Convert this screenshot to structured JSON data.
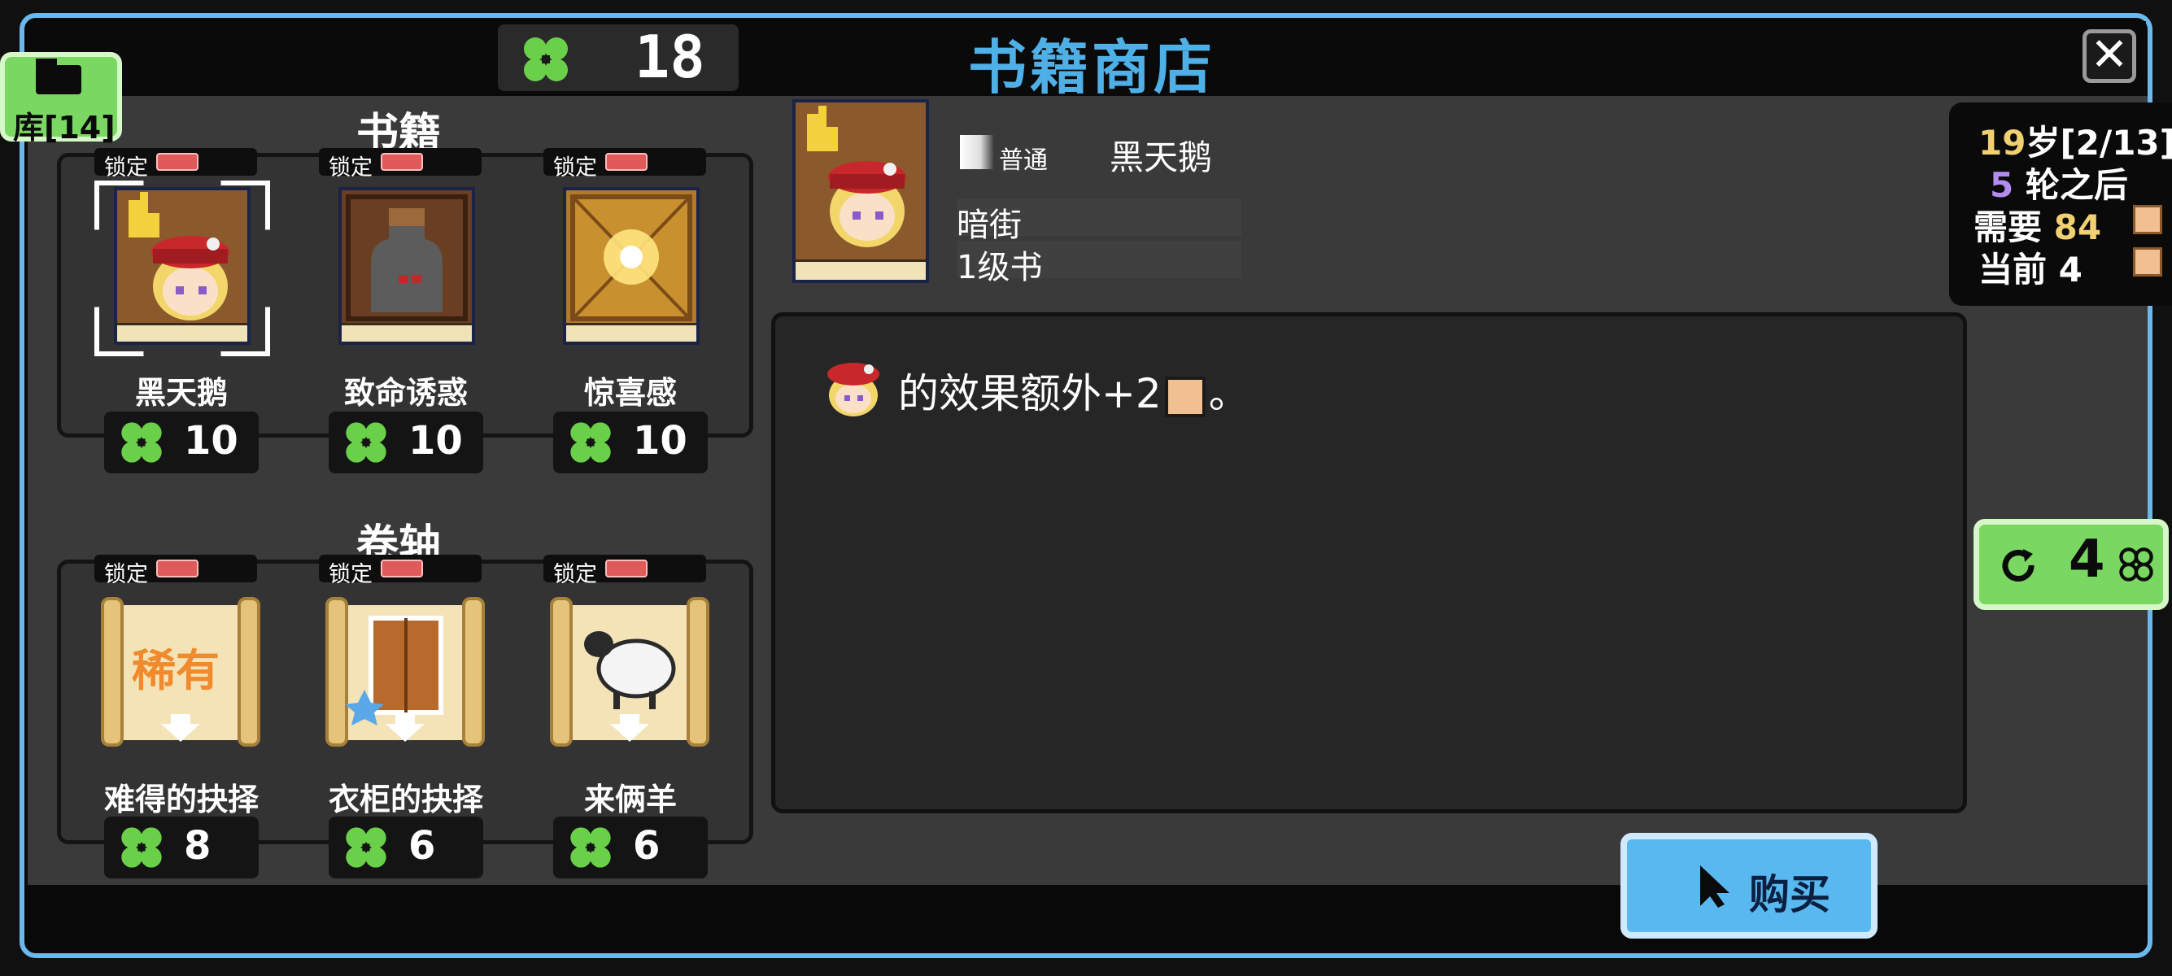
{
  "header": {
    "currency_icon": "clover-icon",
    "currency_amount": "18",
    "title": "书籍商店",
    "close_icon": "close-icon"
  },
  "library_tab": {
    "label": "库[14]",
    "icon": "folder-icon"
  },
  "books_section": {
    "title": "书籍",
    "items": [
      {
        "lock_label": "锁定",
        "name": "黑天鹅",
        "price": "10",
        "selected": true
      },
      {
        "lock_label": "锁定",
        "name": "致命诱惑",
        "price": "10"
      },
      {
        "lock_label": "锁定",
        "name": "惊喜感",
        "price": "10"
      }
    ]
  },
  "scrolls_section": {
    "title": "卷轴",
    "items": [
      {
        "lock_label": "锁定",
        "name": "难得的抉择",
        "price": "8",
        "badge": "稀有"
      },
      {
        "lock_label": "锁定",
        "name": "衣柜的抉择",
        "price": "6"
      },
      {
        "lock_label": "锁定",
        "name": "来俩羊",
        "price": "6"
      }
    ]
  },
  "detail": {
    "rarity": "普通",
    "name": "黑天鹅",
    "category": "暗街",
    "level": "1级书",
    "description_prefix": "的效果额外+2",
    "description_suffix": "。"
  },
  "info_panel": {
    "age_number": "19",
    "age_rest": "岁[2/13]",
    "rounds_number": "5",
    "rounds_rest": " 轮之后",
    "need_label": "需要 ",
    "need_value": "84",
    "current_label": "当前 4"
  },
  "refresh": {
    "count": "4",
    "icon": "refresh-icon"
  },
  "buy_button": {
    "label": "购买",
    "icon": "cursor-icon"
  },
  "colors": {
    "accent_blue": "#4fb0e8",
    "clover_green": "#7ad862",
    "lock_red": "#e05a5a",
    "need_yellow": "#f0d070",
    "rounds_purple": "#b48cf0"
  }
}
